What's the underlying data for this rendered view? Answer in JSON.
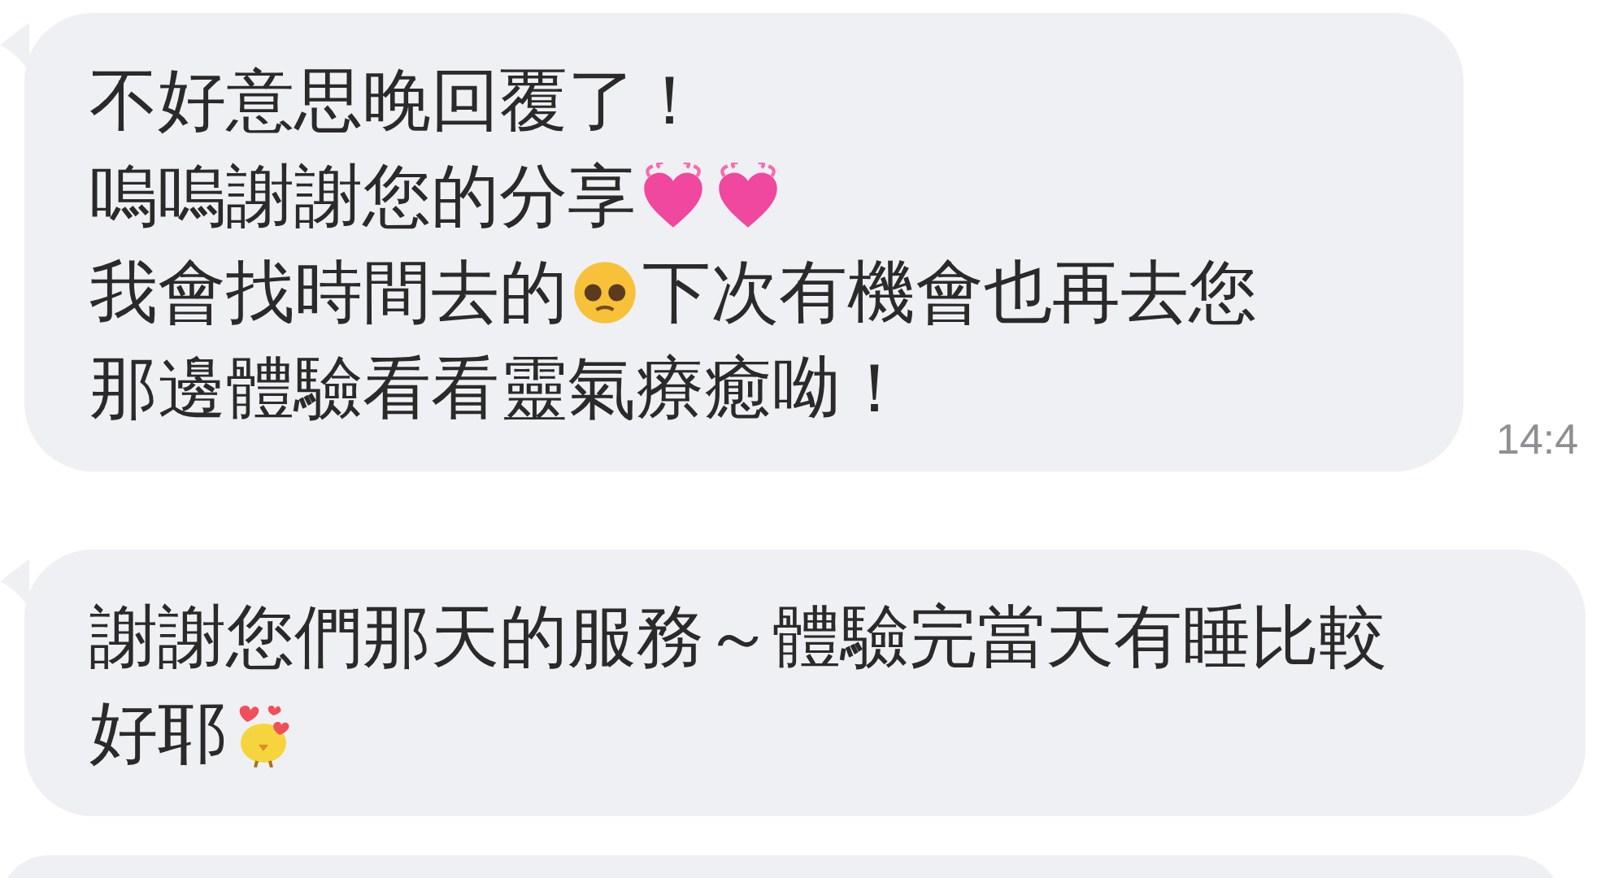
{
  "messages": [
    {
      "lines": [
        [
          {
            "kind": "text",
            "text": "不好意思晚回覆了！"
          }
        ],
        [
          {
            "kind": "text",
            "text": "嗚嗚謝謝您的分享"
          },
          {
            "kind": "heart"
          },
          {
            "kind": "heart"
          }
        ],
        [
          {
            "kind": "text",
            "text": "我會找時間去的"
          },
          {
            "kind": "pleading"
          },
          {
            "kind": "text",
            "text": "下次有機會也再去您"
          }
        ],
        [
          {
            "kind": "text",
            "text": "那邊體驗看看靈氣療癒呦！"
          }
        ]
      ],
      "time": "14:4"
    },
    {
      "lines": [
        [
          {
            "kind": "text",
            "text": "謝謝您們那天的服務～體驗完當天有睡比較"
          }
        ],
        [
          {
            "kind": "text",
            "text": "好耶"
          },
          {
            "kind": "chick"
          }
        ]
      ]
    }
  ]
}
